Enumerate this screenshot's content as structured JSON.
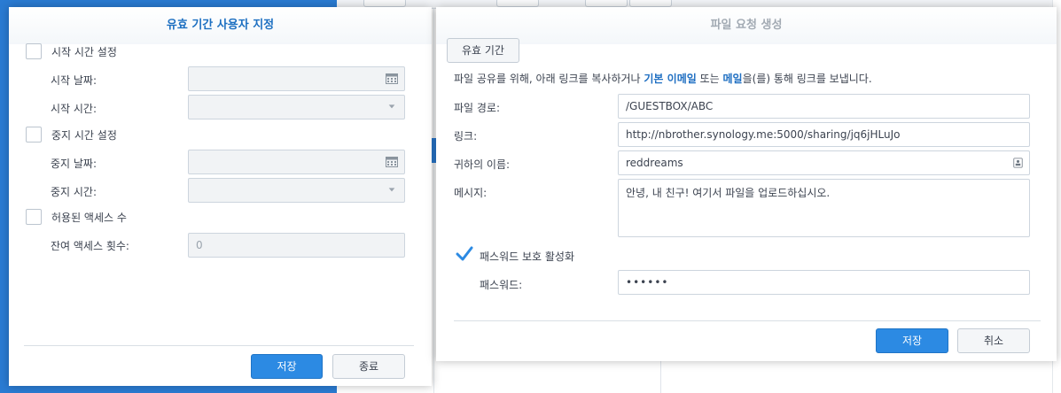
{
  "expiry_dialog": {
    "title": "유효 기간 사용자 지정",
    "start_time": {
      "checkbox_label": "시작 시간 설정",
      "checked": false,
      "date_label": "시작 날짜:",
      "date_value": "",
      "time_label": "시작 시간:",
      "time_value": ""
    },
    "stop_time": {
      "checkbox_label": "중지 시간 설정",
      "checked": false,
      "date_label": "중지 날짜:",
      "date_value": "",
      "time_label": "중지 시간:",
      "time_value": ""
    },
    "access_limit": {
      "checkbox_label": "허용된 액세스 수",
      "checked": false,
      "remaining_label": "잔여 액세스 횟수:",
      "remaining_value": "0"
    },
    "save_label": "저장",
    "close_label": "종료"
  },
  "file_request_dialog": {
    "title": "파일 요청 생성",
    "expiry_button_label": "유효 기간",
    "info": {
      "prefix": "파일 공유를 위해, 아래 링크를 복사하거나 ",
      "link1": "기본 이메일",
      "middle": " 또는 ",
      "link2": "메일",
      "suffix": "을(를) 통해 링크를 보냅니다."
    },
    "file_path_label": "파일 경로:",
    "file_path_value": "/GUESTBOX/ABC",
    "link_label": "링크:",
    "link_value": "http://nbrother.synology.me:5000/sharing/jq6jHLuJo",
    "name_label": "귀하의 이름:",
    "name_value": "reddreams",
    "message_label": "메시지:",
    "message_value": "안녕, 내 친구! 여기서 파일을 업로드하십시오.",
    "password_protect_label": "패스워드 보호 활성화",
    "password_protect_checked": true,
    "password_label": "패스워드:",
    "password_value": "••••••",
    "save_label": "저장",
    "cancel_label": "취소"
  },
  "colors": {
    "accent": "#2c8ae3",
    "title_blue": "#1c6fc1",
    "link_blue": "#1f6fc2"
  }
}
